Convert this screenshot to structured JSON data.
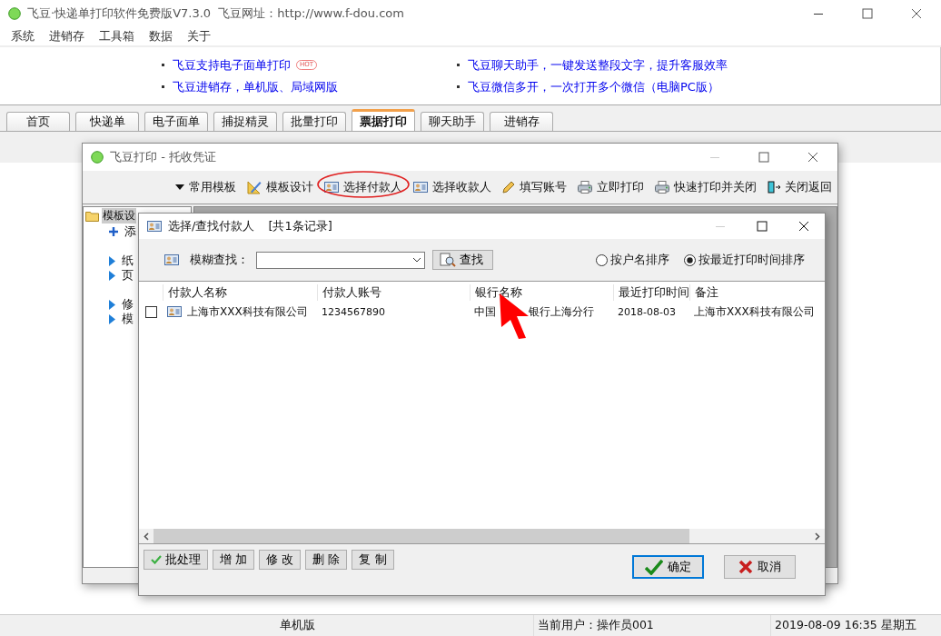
{
  "main_window": {
    "title": "飞豆·快递单打印软件免费版V7.3.0  飞豆网址：http://www.f-dou.com"
  },
  "menu": [
    "系统",
    "进销存",
    "工具箱",
    "数据",
    "关于"
  ],
  "news": [
    {
      "text": "飞豆支持电子面单打印",
      "badge": "HOT"
    },
    {
      "text": "飞豆聊天助手，一键发送整段文字，提升客服效率"
    },
    {
      "text": "飞豆进销存，单机版、局域网版"
    },
    {
      "text": "飞豆微信多开，一次打开多个微信（电脑PC版）"
    }
  ],
  "tabs": [
    {
      "label": "首页",
      "selected": false
    },
    {
      "label": "快递单",
      "selected": false
    },
    {
      "label": "电子面单",
      "selected": false
    },
    {
      "label": "捕捉精灵",
      "selected": false
    },
    {
      "label": "批量打印",
      "selected": false
    },
    {
      "label": "票据打印",
      "selected": true
    },
    {
      "label": "聊天助手",
      "selected": false
    },
    {
      "label": "进销存",
      "selected": false
    }
  ],
  "template_window": {
    "title": "飞豆打印 - 托收凭证",
    "toolbar": [
      {
        "label": "常用模板",
        "kind": "dropdown",
        "circled": false
      },
      {
        "label": "模板设计",
        "kind": "design",
        "circled": false
      },
      {
        "label": "选择付款人",
        "kind": "card",
        "circled": true
      },
      {
        "label": "选择收款人",
        "kind": "card",
        "circled": false
      },
      {
        "label": "填写账号",
        "kind": "pencil",
        "circled": false
      },
      {
        "label": "立即打印",
        "kind": "printer",
        "circled": false
      },
      {
        "label": "快速打印并关闭",
        "kind": "printer",
        "circled": false
      },
      {
        "label": "关闭返回",
        "kind": "exit",
        "circled": false
      }
    ],
    "tree": {
      "label": "模板设",
      "selected": true,
      "children": [
        {
          "label": "添",
          "kind": "add",
          "selected": false
        },
        {
          "label": "纸",
          "kind": "item",
          "selected": false
        },
        {
          "label": "页",
          "kind": "item",
          "selected": false
        },
        {
          "label": "修",
          "kind": "item",
          "selected": false
        },
        {
          "label": "模",
          "kind": "item",
          "selected": false
        }
      ]
    }
  },
  "dialog": {
    "title": "选择/查找付款人",
    "record_count": "[共1条记录]",
    "search_label": "模糊查找：",
    "search_button": "查找",
    "sort_options": [
      {
        "label": "按户名排序",
        "selected": false
      },
      {
        "label": "按最近打印时间排序",
        "selected": true
      }
    ],
    "table": {
      "columns": [
        "付款人名称",
        "付款人账号",
        "银行名称",
        "最近打印时间",
        "备注"
      ],
      "rows": [
        {
          "checked": false,
          "payer_name": "上海市XXX科技有限公司",
          "account": "1234567890",
          "bank_name_parts": [
            "中国",
            "银行上海分行"
          ],
          "last_print": "2018-08-03",
          "remark": "上海市XXX科技有限公司"
        }
      ]
    },
    "actions": [
      {
        "label": "批处理",
        "kind": "check"
      },
      {
        "label": "增 加",
        "kind": "plain"
      },
      {
        "label": "修 改",
        "kind": "plain"
      },
      {
        "label": "删 除",
        "kind": "plain"
      },
      {
        "label": "复 制",
        "kind": "plain"
      }
    ],
    "confirm": "确定",
    "cancel": "取消"
  },
  "status_bar": [
    "单机版",
    "当前用户：操作员001",
    "2019-08-09 16:35 星期五"
  ]
}
